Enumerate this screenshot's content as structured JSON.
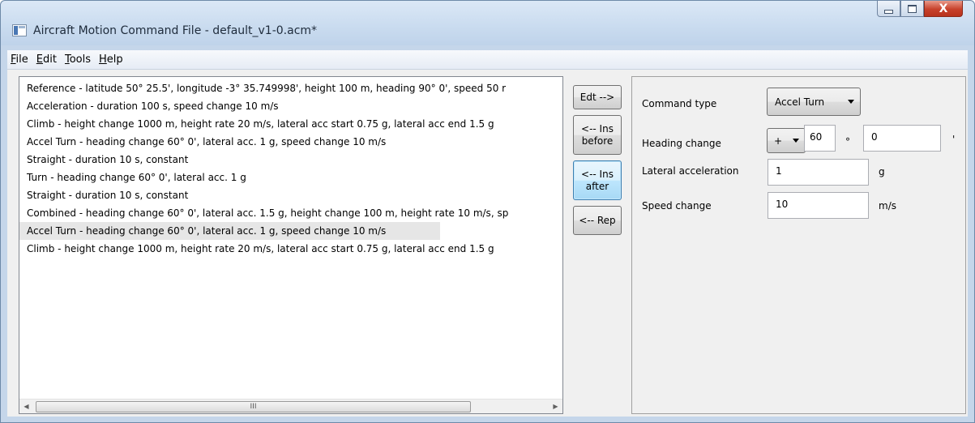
{
  "window": {
    "title": "Aircraft Motion Command File - default_v1-0.acm*"
  },
  "menu": [
    {
      "pre": "",
      "u": "F",
      "post": "ile"
    },
    {
      "pre": "",
      "u": "E",
      "post": "dit"
    },
    {
      "pre": "",
      "u": "T",
      "post": "ools"
    },
    {
      "pre": "",
      "u": "H",
      "post": "elp"
    }
  ],
  "commands": [
    "Reference - latitude 50° 25.5', longitude -3° 35.749998', height 100 m, heading 90° 0', speed 50 r",
    "Acceleration - duration 100 s, speed change 10 m/s",
    "Climb - height change 1000 m, height rate 20 m/s, lateral acc start 0.75 g, lateral acc end 1.5 g",
    "Accel Turn - heading change 60° 0', lateral acc. 1 g, speed change 10 m/s",
    "Straight - duration 10 s, constant",
    "Turn - heading change 60° 0', lateral acc. 1 g",
    "Straight - duration 10 s, constant",
    "Combined - heading change 60° 0', lateral acc. 1.5 g, height change 100 m, height rate 10 m/s, sp",
    "Accel Turn - heading change 60° 0', lateral acc. 1 g, speed change 10 m/s",
    "Climb - height change 1000 m, height rate 20 m/s, lateral acc start 0.75 g, lateral acc end 1.5 g"
  ],
  "selected_index": 8,
  "scrollbar": {
    "thumb_grip": "III",
    "left_arrow": "◀",
    "right_arrow": "▶"
  },
  "buttons": {
    "edit": "Edt -->",
    "insert_before_1": "<-- Ins",
    "insert_before_2": "before",
    "insert_after_1": "<-- Ins",
    "insert_after_2": "after",
    "replace": "<-- Rep"
  },
  "editor": {
    "command_type_label": "Command type",
    "command_type_value": "Accel Turn",
    "heading_change_label": "Heading change",
    "heading_sign": "+",
    "heading_degrees": "60",
    "degree_symbol": "°",
    "heading_minutes": "0",
    "minute_symbol": "'",
    "lateral_accel_label": "Lateral acceleration",
    "lateral_accel_value": "1",
    "lateral_accel_unit": "g",
    "speed_change_label": "Speed change",
    "speed_change_value": "10",
    "speed_change_unit": "m/s"
  },
  "caption": {
    "minimize": "",
    "maximize": "",
    "close": "X"
  }
}
